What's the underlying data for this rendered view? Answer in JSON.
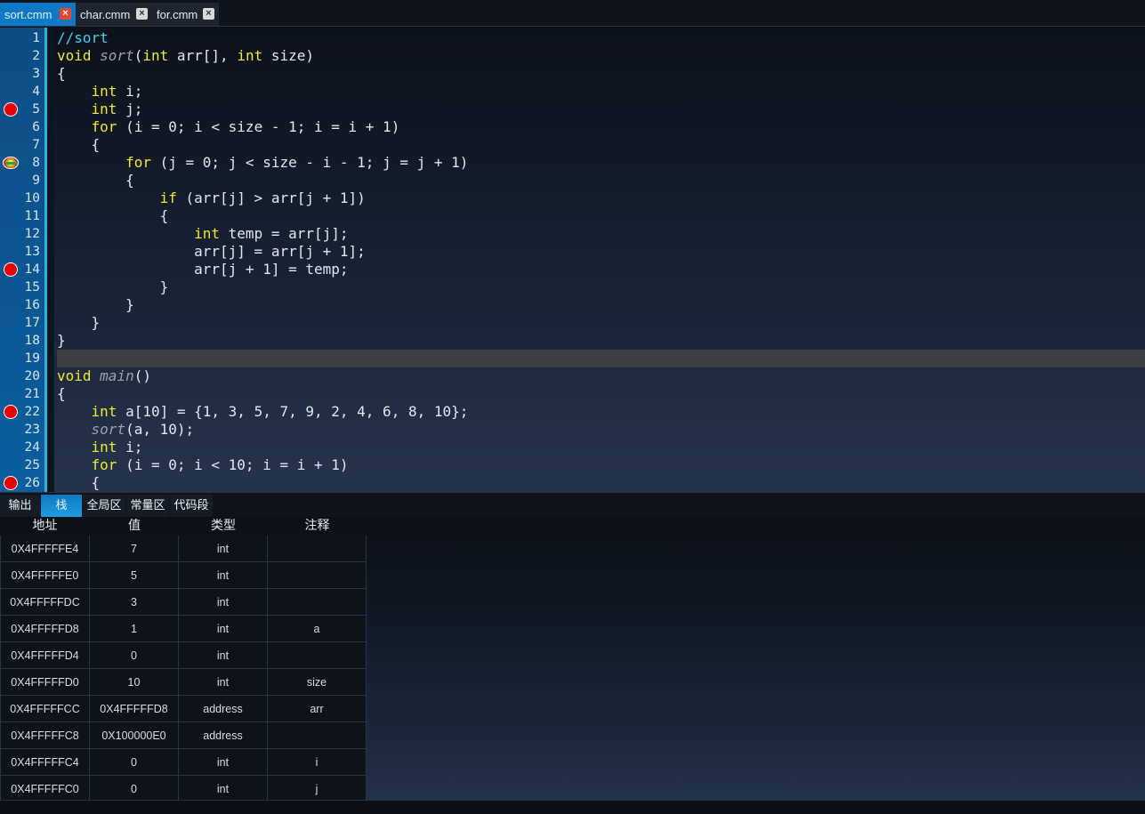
{
  "file_tabs": [
    {
      "label": "sort.cmm",
      "active": true
    },
    {
      "label": "char.cmm",
      "active": false
    },
    {
      "label": "for.cmm",
      "active": false
    }
  ],
  "close_glyph": "×",
  "editor": {
    "current_line": 19,
    "breakpoints": [
      5,
      14,
      22,
      26
    ],
    "execution_line": 8,
    "lines": [
      [
        {
          "t": "cm",
          "v": "//sort"
        }
      ],
      [
        {
          "t": "kw",
          "v": "void"
        },
        {
          "t": "tx",
          "v": " "
        },
        {
          "t": "fn",
          "v": "sort"
        },
        {
          "t": "tx",
          "v": "("
        },
        {
          "t": "kw",
          "v": "int"
        },
        {
          "t": "tx",
          "v": " arr[], "
        },
        {
          "t": "kw",
          "v": "int"
        },
        {
          "t": "tx",
          "v": " size)"
        }
      ],
      [
        {
          "t": "tx",
          "v": "{"
        }
      ],
      [
        {
          "t": "tx",
          "v": "    "
        },
        {
          "t": "kw",
          "v": "int"
        },
        {
          "t": "tx",
          "v": " i;"
        }
      ],
      [
        {
          "t": "tx",
          "v": "    "
        },
        {
          "t": "kw",
          "v": "int"
        },
        {
          "t": "tx",
          "v": " j;"
        }
      ],
      [
        {
          "t": "tx",
          "v": "    "
        },
        {
          "t": "kw",
          "v": "for"
        },
        {
          "t": "tx",
          "v": " (i = 0; i < size - 1; i = i + 1)"
        }
      ],
      [
        {
          "t": "tx",
          "v": "    {"
        }
      ],
      [
        {
          "t": "tx",
          "v": "        "
        },
        {
          "t": "kw",
          "v": "for"
        },
        {
          "t": "tx",
          "v": " (j = 0; j < size - i - 1; j = j + 1)"
        }
      ],
      [
        {
          "t": "tx",
          "v": "        {"
        }
      ],
      [
        {
          "t": "tx",
          "v": "            "
        },
        {
          "t": "kw",
          "v": "if"
        },
        {
          "t": "tx",
          "v": " (arr[j] > arr[j + 1])"
        }
      ],
      [
        {
          "t": "tx",
          "v": "            {"
        }
      ],
      [
        {
          "t": "tx",
          "v": "                "
        },
        {
          "t": "kw",
          "v": "int"
        },
        {
          "t": "tx",
          "v": " temp = arr[j];"
        }
      ],
      [
        {
          "t": "tx",
          "v": "                arr[j] = arr[j + 1];"
        }
      ],
      [
        {
          "t": "tx",
          "v": "                arr[j + 1] = temp;"
        }
      ],
      [
        {
          "t": "tx",
          "v": "            }"
        }
      ],
      [
        {
          "t": "tx",
          "v": "        }"
        }
      ],
      [
        {
          "t": "tx",
          "v": "    }"
        }
      ],
      [
        {
          "t": "tx",
          "v": "}"
        }
      ],
      [
        {
          "t": "tx",
          "v": ""
        }
      ],
      [
        {
          "t": "kw",
          "v": "void"
        },
        {
          "t": "tx",
          "v": " "
        },
        {
          "t": "fn",
          "v": "main"
        },
        {
          "t": "tx",
          "v": "()"
        }
      ],
      [
        {
          "t": "tx",
          "v": "{"
        }
      ],
      [
        {
          "t": "tx",
          "v": "    "
        },
        {
          "t": "kw",
          "v": "int"
        },
        {
          "t": "tx",
          "v": " a[10] = {1, 3, 5, 7, 9, 2, 4, 6, 8, 10};"
        }
      ],
      [
        {
          "t": "tx",
          "v": "    "
        },
        {
          "t": "fn",
          "v": "sort"
        },
        {
          "t": "tx",
          "v": "(a, 10);"
        }
      ],
      [
        {
          "t": "tx",
          "v": "    "
        },
        {
          "t": "kw",
          "v": "int"
        },
        {
          "t": "tx",
          "v": " i;"
        }
      ],
      [
        {
          "t": "tx",
          "v": "    "
        },
        {
          "t": "kw",
          "v": "for"
        },
        {
          "t": "tx",
          "v": " (i = 0; i < 10; i = i + 1)"
        }
      ],
      [
        {
          "t": "tx",
          "v": "    {"
        }
      ]
    ]
  },
  "panel_tabs": [
    {
      "label": "输出",
      "active": false
    },
    {
      "label": "栈",
      "active": true
    },
    {
      "label": "全局区",
      "active": false
    },
    {
      "label": "常量区",
      "active": false
    },
    {
      "label": "代码段",
      "active": false
    }
  ],
  "stack_table": {
    "headers": [
      "地址",
      "值",
      "类型",
      "注释"
    ],
    "rows": [
      [
        "0X4FFFFFE4",
        "7",
        "int",
        ""
      ],
      [
        "0X4FFFFFE0",
        "5",
        "int",
        ""
      ],
      [
        "0X4FFFFFDC",
        "3",
        "int",
        ""
      ],
      [
        "0X4FFFFFD8",
        "1",
        "int",
        "a"
      ],
      [
        "0X4FFFFFD4",
        "0",
        "int",
        ""
      ],
      [
        "0X4FFFFFD0",
        "10",
        "int",
        "size"
      ],
      [
        "0X4FFFFFCC",
        "0X4FFFFFD8",
        "address",
        "arr"
      ],
      [
        "0X4FFFFFC8",
        "0X100000E0",
        "address",
        ""
      ],
      [
        "0X4FFFFFC4",
        "0",
        "int",
        "i"
      ],
      [
        "0X4FFFFFC0",
        "0",
        "int",
        "j"
      ]
    ]
  },
  "colors": {
    "keyword": "#f2ea2c",
    "comment": "#3cd4f0",
    "function": "#9aa3af",
    "accent": "#0e79c6",
    "breakpoint": "#e60000"
  }
}
